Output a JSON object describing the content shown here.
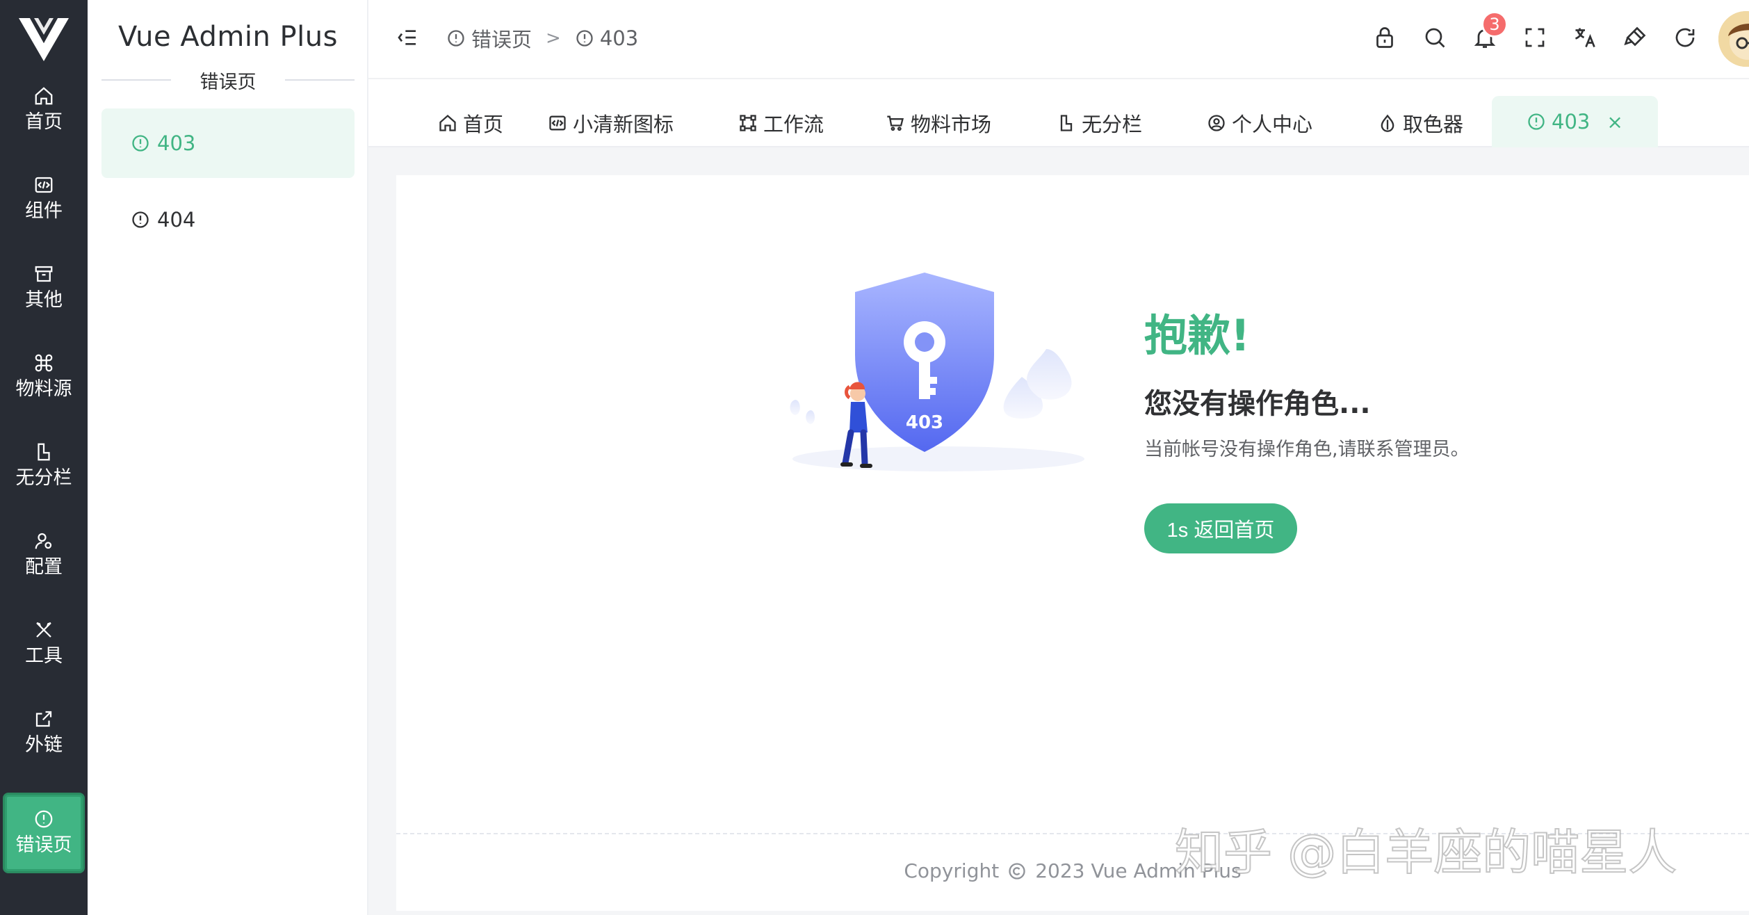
{
  "rail": {
    "items": [
      {
        "label": "首页",
        "icon": "home-icon"
      },
      {
        "label": "组件",
        "icon": "code-icon"
      },
      {
        "label": "其他",
        "icon": "archive-icon"
      },
      {
        "label": "物料源",
        "icon": "command-icon"
      },
      {
        "label": "无分栏",
        "icon": "layout-icon"
      },
      {
        "label": "配置",
        "icon": "user-settings-icon"
      },
      {
        "label": "工具",
        "icon": "tools-icon"
      },
      {
        "label": "外链",
        "icon": "external-link-icon"
      },
      {
        "label": "错误页",
        "icon": "error-icon",
        "active": true
      }
    ]
  },
  "subbar": {
    "title": "Vue Admin Plus",
    "group": "错误页",
    "items": [
      {
        "label": "403",
        "active": true
      },
      {
        "label": "404",
        "active": false
      }
    ]
  },
  "header": {
    "breadcrumb": [
      "错误页",
      "403"
    ],
    "separator": ">",
    "notification_count": "3"
  },
  "tabs": [
    {
      "label": "首页",
      "icon": "home-icon"
    },
    {
      "label": "小清新图标",
      "icon": "code-icon"
    },
    {
      "label": "工作流",
      "icon": "flow-icon"
    },
    {
      "label": "物料市场",
      "icon": "cart-icon"
    },
    {
      "label": "无分栏",
      "icon": "layout-icon"
    },
    {
      "label": "个人中心",
      "icon": "user-icon"
    },
    {
      "label": "取色器",
      "icon": "drop-icon"
    },
    {
      "label": "403",
      "icon": "error-icon",
      "active": true,
      "close": "×"
    }
  ],
  "error": {
    "code": "403",
    "title": "抱歉!",
    "subtitle": "您没有操作角色...",
    "description": "当前帐号没有操作角色,请联系管理员。",
    "button": "1s 返回首页"
  },
  "footer": {
    "copyright_word": "Copyright",
    "copyright_text": "2023 Vue Admin Plus"
  },
  "watermark": "知乎 @白羊座的喵星人",
  "colors": {
    "accent": "#41b584",
    "rail_bg": "#282c34",
    "badge": "#f56c6c"
  }
}
